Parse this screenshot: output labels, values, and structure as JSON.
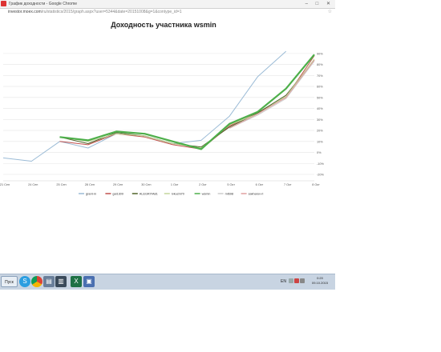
{
  "window": {
    "title": "График доходности - Google Chrome",
    "controls": "– □ ✕"
  },
  "address": {
    "host": "investor.moex.com",
    "path": "/ru/statistics/2015/graph.aspx?user=5344&date=20151008&g=1&contype_id=1"
  },
  "chart_data": {
    "type": "line",
    "title": "Доходность участника wsmin",
    "xlabel": "",
    "ylabel": "",
    "categories": [
      "21 Сен",
      "24 Сен",
      "25 Сен",
      "28 Сен",
      "29 Сен",
      "30 Сен",
      "1 Окт",
      "2 Окт",
      "5 Окт",
      "6 Окт",
      "7 Окт",
      "8 Окт"
    ],
    "y_ticks": [
      "-20%",
      "-10%",
      "0%",
      "10%",
      "20%",
      "30%",
      "40%",
      "50%",
      "60%",
      "70%",
      "80%",
      "90%"
    ],
    "ylim": [
      -20,
      95
    ],
    "grid": true,
    "legend_position": "bottom",
    "series": [
      {
        "name": "grant-m",
        "color": "#9bbbd6",
        "values": [
          -5,
          -8,
          10,
          4,
          17,
          15,
          8,
          11,
          33,
          69,
          92,
          null
        ],
        "x_index_offset": -0.5
      },
      {
        "name": "gal1309",
        "color": "#c0504d",
        "values": [
          null,
          null,
          10,
          7,
          17,
          14,
          7,
          3,
          24,
          36,
          50,
          88
        ]
      },
      {
        "name": "ALEGRIYA81",
        "color": "#4f6228",
        "values": [
          null,
          null,
          14,
          8,
          18,
          15,
          8,
          5,
          23,
          36,
          52,
          84
        ]
      },
      {
        "name": "Ivkuchi70",
        "color": "#c3d69b",
        "values": [
          null,
          null,
          14,
          10,
          17,
          15,
          8,
          4,
          25,
          35,
          51,
          85
        ]
      },
      {
        "name": "wsmin",
        "color": "#4daf4a",
        "values": [
          null,
          null,
          14,
          11,
          19,
          17,
          10,
          3,
          26,
          37,
          58,
          89
        ]
      },
      {
        "name": "ml698",
        "color": "#cccccc",
        "values": [
          null,
          null,
          null,
          null,
          null,
          null,
          null,
          null,
          22,
          34,
          49,
          83
        ]
      },
      {
        "name": "sakharov-ri",
        "color": "#e0a0a0",
        "values": [
          null,
          null,
          null,
          null,
          null,
          null,
          null,
          null,
          22,
          35,
          50,
          84
        ]
      }
    ]
  },
  "taskbar": {
    "start_label": "Пуск",
    "lang": "EN",
    "time": "0:20",
    "date": "09.10.2015"
  },
  "colors": {
    "taskbar_bg": "#c8d4e2",
    "accent_green": "#4daf4a"
  }
}
